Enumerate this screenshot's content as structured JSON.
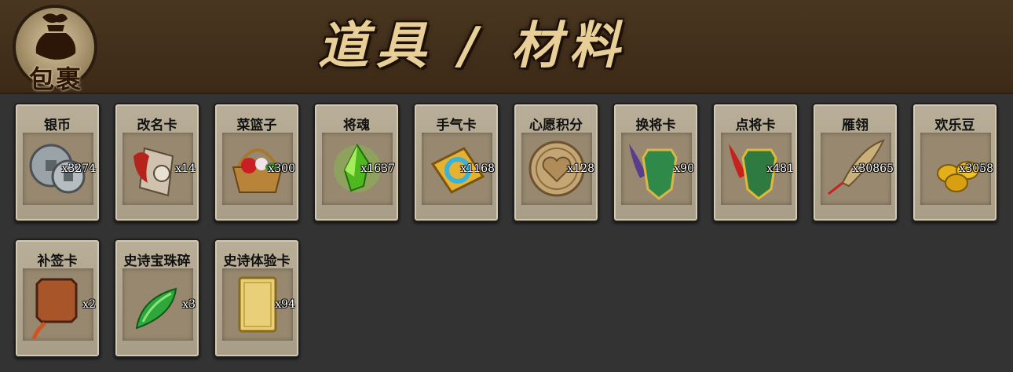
{
  "header": {
    "bag_label": "包裹",
    "title": "道具 / 材料"
  },
  "items": [
    {
      "name": "银币",
      "count": "x3274",
      "icon": "silver-coins-icon"
    },
    {
      "name": "改名卡",
      "count": "x14",
      "icon": "rename-card-icon"
    },
    {
      "name": "菜篮子",
      "count": "x300",
      "icon": "vegetable-basket-icon"
    },
    {
      "name": "将魂",
      "count": "x1637",
      "icon": "green-crystal-icon"
    },
    {
      "name": "手气卡",
      "count": "x1168",
      "icon": "luck-card-icon"
    },
    {
      "name": "心愿积分",
      "count": "x128",
      "icon": "heart-coin-icon"
    },
    {
      "name": "换将卡",
      "count": "x90",
      "icon": "swap-general-card-icon"
    },
    {
      "name": "点将卡",
      "count": "x481",
      "icon": "pick-general-card-icon"
    },
    {
      "name": "雁翎",
      "count": "x30865",
      "icon": "feather-icon"
    },
    {
      "name": "欢乐豆",
      "count": "x3058",
      "icon": "gold-beans-icon"
    },
    {
      "name": "补签卡",
      "count": "x2",
      "icon": "makeup-sign-card-icon"
    },
    {
      "name": "史诗宝珠碎",
      "count": "x3",
      "icon": "jade-shard-icon"
    },
    {
      "name": "史诗体验卡",
      "count": "x94",
      "icon": "gold-card-icon"
    }
  ],
  "colors": {
    "background": "#333333",
    "header": "#3c2a17",
    "card": "#a89d86",
    "title": "#e8cf98"
  }
}
